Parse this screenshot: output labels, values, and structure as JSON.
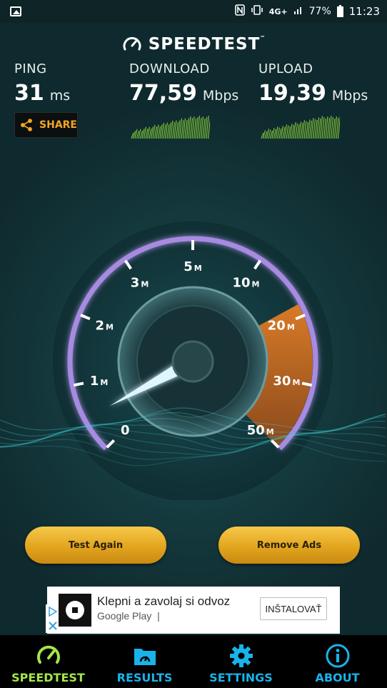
{
  "status_bar": {
    "network": "4G+",
    "battery": "77%",
    "time": "11:23",
    "icons": [
      "image-icon",
      "nfc-icon",
      "vibrate-icon",
      "signal-icon",
      "battery-icon"
    ]
  },
  "header": {
    "title": "SPEEDTEST",
    "trademark": "™"
  },
  "metrics": {
    "ping": {
      "label": "PING",
      "value": "31",
      "unit": "ms"
    },
    "download": {
      "label": "DOWNLOAD",
      "value": "77,59",
      "unit": "Mbps"
    },
    "upload": {
      "label": "UPLOAD",
      "value": "19,39",
      "unit": "Mbps"
    }
  },
  "share": {
    "label": "SHARE"
  },
  "gauge": {
    "ticks": [
      {
        "num": "0",
        "suffix": ""
      },
      {
        "num": "1",
        "suffix": "M"
      },
      {
        "num": "2",
        "suffix": "M"
      },
      {
        "num": "3",
        "suffix": "M"
      },
      {
        "num": "5",
        "suffix": "M"
      },
      {
        "num": "10",
        "suffix": "M"
      },
      {
        "num": "20",
        "suffix": "M"
      },
      {
        "num": "30",
        "suffix": "M"
      },
      {
        "num": "50",
        "suffix": "M"
      }
    ],
    "needle_value_mbps": 0.5
  },
  "buttons": {
    "test_again": "Test Again",
    "remove_ads": "Remove Ads"
  },
  "ad": {
    "title": "Klepni a zavolaj si odvoz",
    "store": "Google Play",
    "separator": "|",
    "install": "INŠTALOVAŤ"
  },
  "nav": [
    {
      "label": "SPEEDTEST",
      "icon": "speedometer-icon",
      "active": true
    },
    {
      "label": "RESULTS",
      "icon": "results-folder-icon",
      "active": false
    },
    {
      "label": "SETTINGS",
      "icon": "gear-icon",
      "active": false
    },
    {
      "label": "ABOUT",
      "icon": "info-icon",
      "active": false
    }
  ],
  "colors": {
    "accent_green": "#a4e64a",
    "accent_blue": "#19b3ea",
    "share_orange": "#f5a623",
    "gauge_orange": "#d2691e",
    "button_gold": "#e2a51e"
  }
}
